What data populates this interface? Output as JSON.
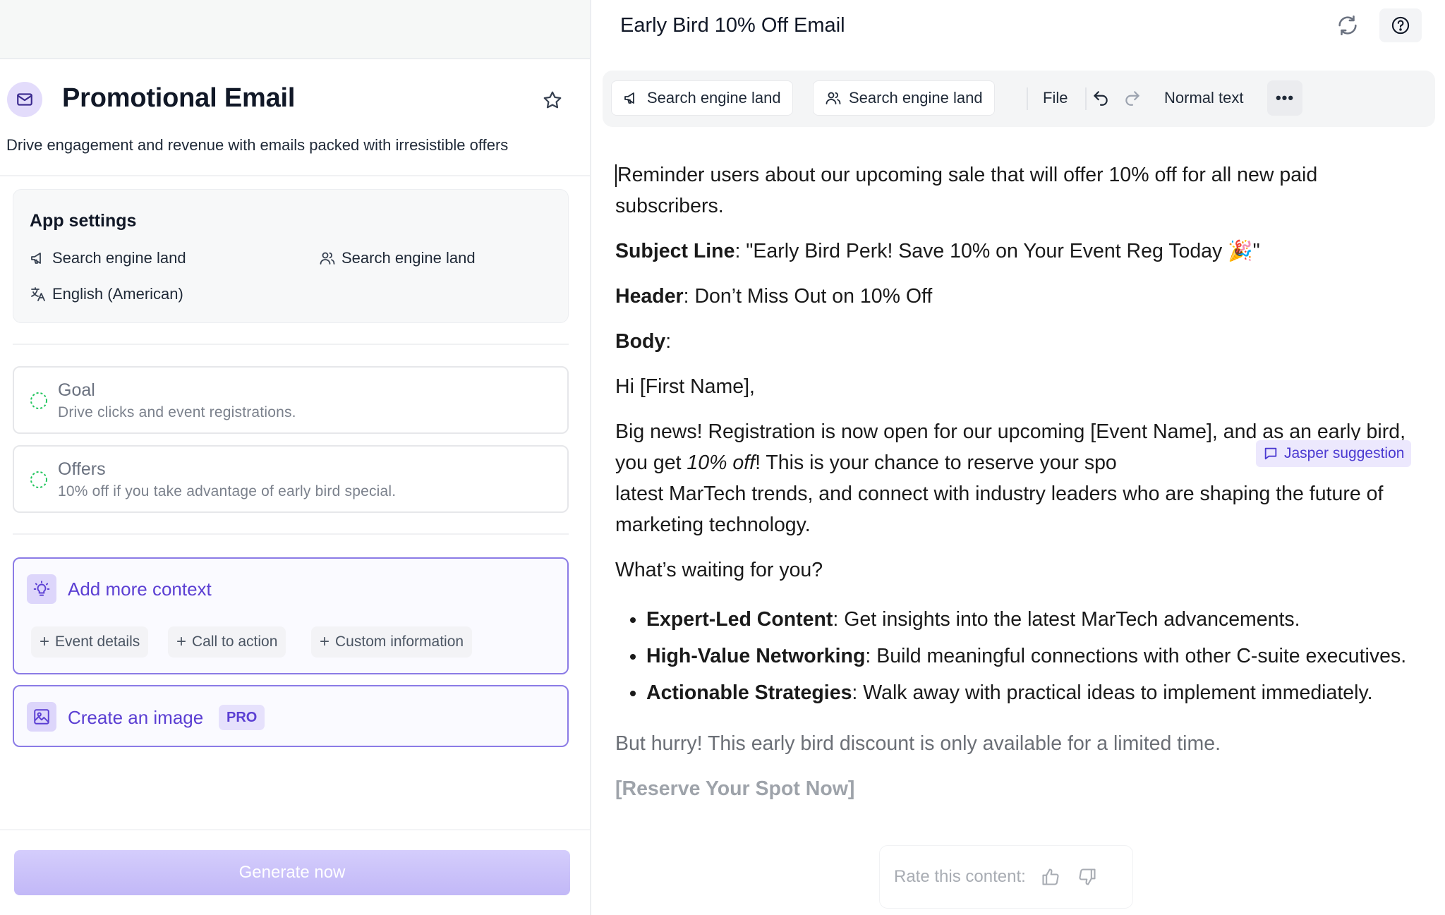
{
  "left": {
    "app_title": "Promotional Email",
    "app_description": "Drive engagement and revenue with emails packed with irresistible offers",
    "settings": {
      "title": "App settings",
      "brand_voice": "Search engine land",
      "audience": "Search engine land",
      "language": "English (American)"
    },
    "context_fields": [
      {
        "label": "Goal",
        "value": "Drive clicks and event registrations."
      },
      {
        "label": "Offers",
        "value": "10% off if you take advantage of early bird special."
      }
    ],
    "add_context": {
      "title": "Add more context",
      "chips": [
        "Event details",
        "Call to action",
        "Custom information"
      ]
    },
    "create_image": {
      "title": "Create an image",
      "badge": "PRO"
    },
    "generate_label": "Generate now"
  },
  "right": {
    "doc_title": "Early Bird 10% Off Email",
    "toolbar": {
      "voice": "Search engine land",
      "audience": "Search engine land",
      "file": "File",
      "text_style": "Normal text",
      "more": "•••"
    },
    "doc": {
      "intro": "Reminder users about our upcoming sale that will offer 10% off for all new paid subscribers.",
      "subject_label": "Subject Line",
      "subject_text": ": \"Early Bird Perk! Save 10% on Your Event Reg Today 🎉\"",
      "header_label": "Header",
      "header_text": ": Don’t Miss Out on 10% Off",
      "body_label": "Body",
      "body_colon": ":",
      "greeting": "Hi [First Name],",
      "para1_a": "Big news! Registration is now open for our upcoming [Event Name], and as an early bird, you get ",
      "para1_em": "10% off",
      "para1_b": "! This is your chance to reserve your spo",
      "para1_c": "latest MarTech trends, and connect with industry leaders who are shaping the future of marketing technology.",
      "waiting": "What’s waiting for you?",
      "bullets": [
        {
          "label": "Expert-Led Content",
          "text": ": Get insights into the latest MarTech advancements."
        },
        {
          "label": "High-Value Networking",
          "text": ": Build meaningful connections with other C-suite executives."
        },
        {
          "label": "Actionable Strategies",
          "text": ": Walk away with practical ideas to implement immediately."
        }
      ],
      "hurry": "But hurry! This early bird discount is only available for a limited time.",
      "cta": "[Reserve Your Spot Now]"
    },
    "suggestion_label": "Jasper suggestion",
    "rate_label": "Rate this content:"
  },
  "colors": {
    "accent": "#5b3fd3",
    "accent_border": "#8b7be6",
    "accent_bg": "#ddd6fb",
    "generate_button": "#c9c0fa"
  },
  "icons": [
    "mail-icon",
    "star-icon",
    "megaphone-icon",
    "users-icon",
    "translate-icon",
    "dashed-circle-icon",
    "lightbulb-icon",
    "plus-icon",
    "image-icon",
    "sync-icon",
    "help-icon",
    "undo-icon",
    "redo-icon",
    "more-icon",
    "comment-icon",
    "thumbs-up-icon",
    "thumbs-down-icon"
  ]
}
